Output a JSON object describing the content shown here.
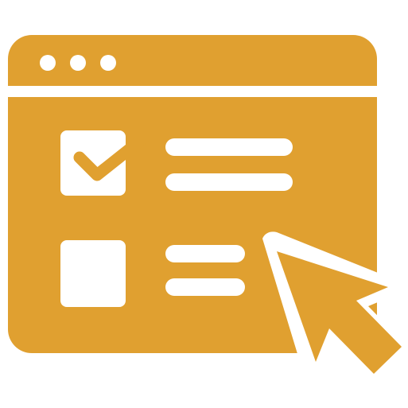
{
  "icon": {
    "name": "browser-checklist-click-icon",
    "colors": {
      "accent": "#E0A030",
      "foreground": "#FFFFFF",
      "background": "#FFFFFF"
    },
    "window_controls": [
      "dot",
      "dot",
      "dot"
    ],
    "checklist": [
      {
        "checked": true
      },
      {
        "checked": false
      }
    ],
    "cursor": "arrow-pointer"
  }
}
